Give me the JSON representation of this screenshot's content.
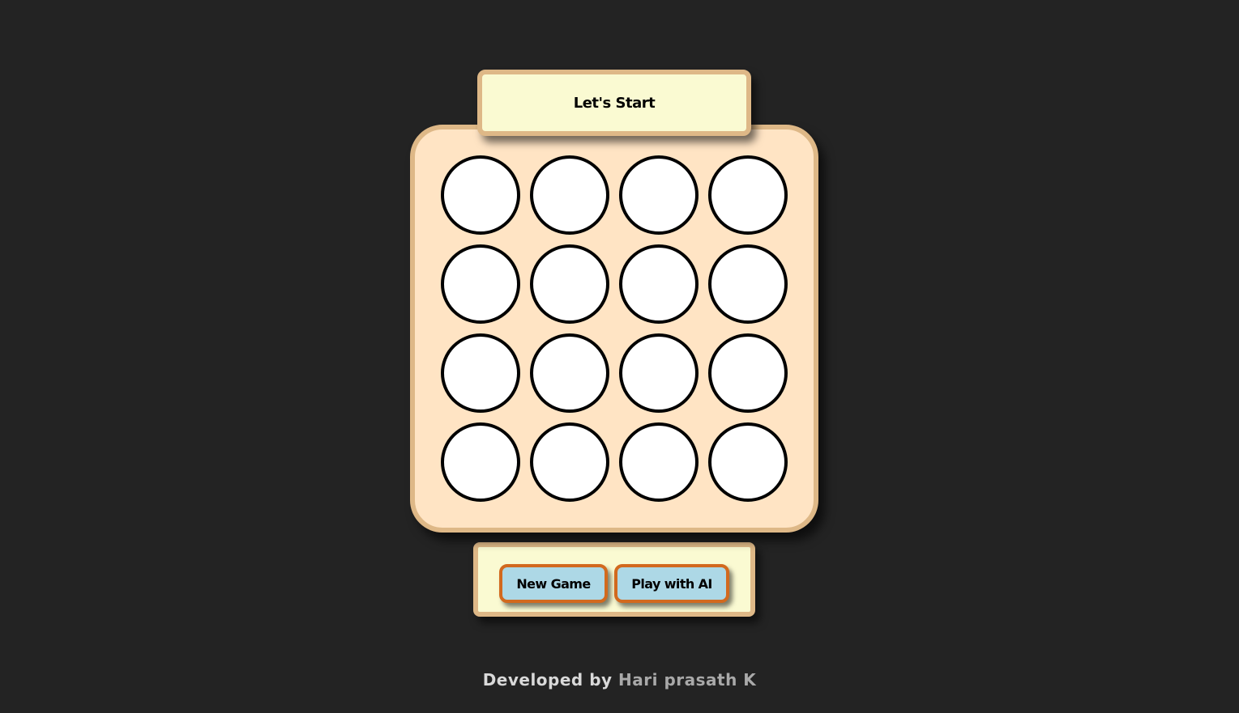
{
  "status": {
    "message": "Let's Start"
  },
  "board": {
    "rows": 4,
    "columns": 4,
    "cells": [
      [
        "",
        "",
        "",
        ""
      ],
      [
        "",
        "",
        "",
        ""
      ],
      [
        "",
        "",
        "",
        ""
      ],
      [
        "",
        "",
        "",
        ""
      ]
    ]
  },
  "controls": {
    "new_game_label": "New Game",
    "play_ai_label": "Play with AI"
  },
  "footer": {
    "prefix": "Developed by",
    "author": "Hari prasath K"
  },
  "colors": {
    "background": "#232323",
    "board_fill": "#ffe4c4",
    "panel_border": "#deb887",
    "panel_fill": "#fafad2",
    "button_fill": "#add8e6",
    "button_border": "#d2691e",
    "cell_fill": "#ffffff",
    "cell_border": "#000000"
  }
}
